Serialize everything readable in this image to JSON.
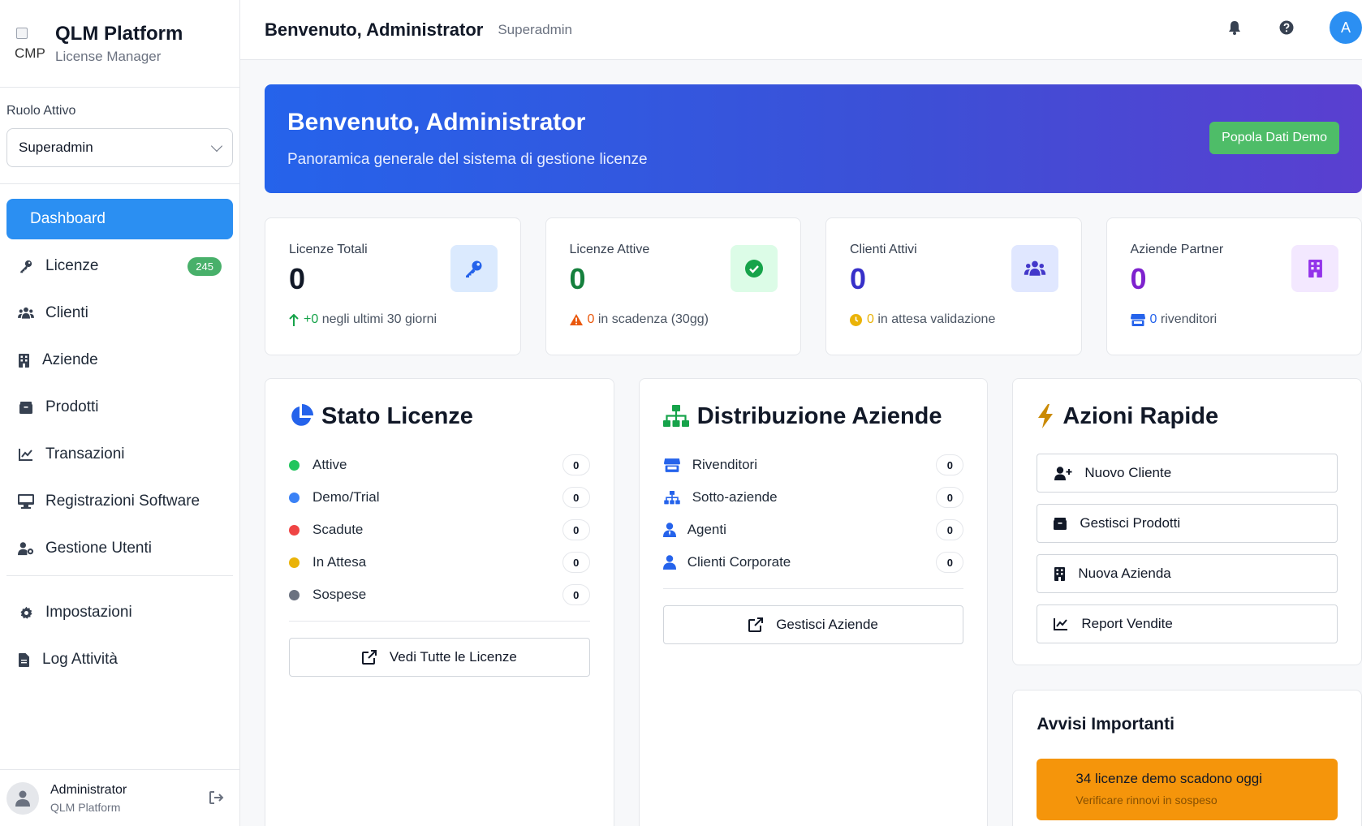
{
  "brand": {
    "logo_alt": "CMP",
    "title": "QLM Platform",
    "subtitle": "License Manager"
  },
  "role": {
    "label": "Ruolo Attivo",
    "selected": "Superadmin"
  },
  "nav": {
    "items": [
      {
        "label": "Dashboard",
        "icon": "dashboard",
        "active": true
      },
      {
        "label": "Licenze",
        "icon": "key-icon",
        "badge": "245"
      },
      {
        "label": "Clienti",
        "icon": "users-icon"
      },
      {
        "label": "Aziende",
        "icon": "building-icon"
      },
      {
        "label": "Prodotti",
        "icon": "box-icon"
      },
      {
        "label": "Transazioni",
        "icon": "chart-line-icon"
      },
      {
        "label": "Registrazioni Software",
        "icon": "monitor-icon"
      },
      {
        "label": "Gestione Utenti",
        "icon": "user-gear-icon"
      }
    ],
    "secondary": [
      {
        "label": "Impostazioni",
        "icon": "gear-icon"
      },
      {
        "label": "Log Attività",
        "icon": "file-icon"
      }
    ]
  },
  "user": {
    "name": "Administrator",
    "org": "QLM Platform"
  },
  "topbar": {
    "title": "Benvenuto, Administrator",
    "role": "Superadmin",
    "avatar_letter": "A"
  },
  "hero": {
    "title": "Benvenuto, Administrator",
    "subtitle": "Panoramica generale del sistema di gestione licenze",
    "button": "Popola Dati Demo"
  },
  "stats": [
    {
      "label": "Licenze Totali",
      "value": "0",
      "foot_value": "+0",
      "foot_text": "negli ultimi 30 giorni",
      "value_color": "#111827",
      "foot_color": "#16a34a"
    },
    {
      "label": "Licenze Attive",
      "value": "0",
      "foot_value": "0",
      "foot_text": "in scadenza (30gg)",
      "value_color": "#15803d",
      "foot_color": "#ea580c"
    },
    {
      "label": "Clienti Attivi",
      "value": "0",
      "foot_value": "0",
      "foot_text": "in attesa validazione",
      "value_color": "#3730c9",
      "foot_color": "#eab308"
    },
    {
      "label": "Aziende Partner",
      "value": "0",
      "foot_value": "0",
      "foot_text": "rivenditori",
      "value_color": "#7e22ce",
      "foot_color": "#2563eb"
    }
  ],
  "stato": {
    "title": "Stato Licenze",
    "rows": [
      {
        "label": "Attive",
        "count": "0",
        "color": "#22c55e"
      },
      {
        "label": "Demo/Trial",
        "count": "0",
        "color": "#3b82f6"
      },
      {
        "label": "Scadute",
        "count": "0",
        "color": "#ef4444"
      },
      {
        "label": "In Attesa",
        "count": "0",
        "color": "#eab308"
      },
      {
        "label": "Sospese",
        "count": "0",
        "color": "#6b7280"
      }
    ],
    "button": "Vedi Tutte le Licenze"
  },
  "distribuzione": {
    "title": "Distribuzione Aziende",
    "rows": [
      {
        "label": "Rivenditori",
        "count": "0",
        "icon": "store-icon"
      },
      {
        "label": "Sotto-aziende",
        "count": "0",
        "icon": "sitemap-icon"
      },
      {
        "label": "Agenti",
        "count": "0",
        "icon": "user-tie-icon"
      },
      {
        "label": "Clienti Corporate",
        "count": "0",
        "icon": "user-icon"
      }
    ],
    "button": "Gestisci Aziende"
  },
  "azioni": {
    "title": "Azioni Rapide",
    "buttons": [
      {
        "label": "Nuovo Cliente",
        "icon": "user-plus-icon"
      },
      {
        "label": "Gestisci Prodotti",
        "icon": "box-icon"
      },
      {
        "label": "Nuova Azienda",
        "icon": "building-icon"
      },
      {
        "label": "Report Vendite",
        "icon": "chart-line-icon"
      }
    ]
  },
  "avvisi": {
    "title": "Avvisi Importanti",
    "alert_title": "34 licenze demo scadono oggi",
    "alert_sub": "Verificare rinnovi in sospeso"
  }
}
